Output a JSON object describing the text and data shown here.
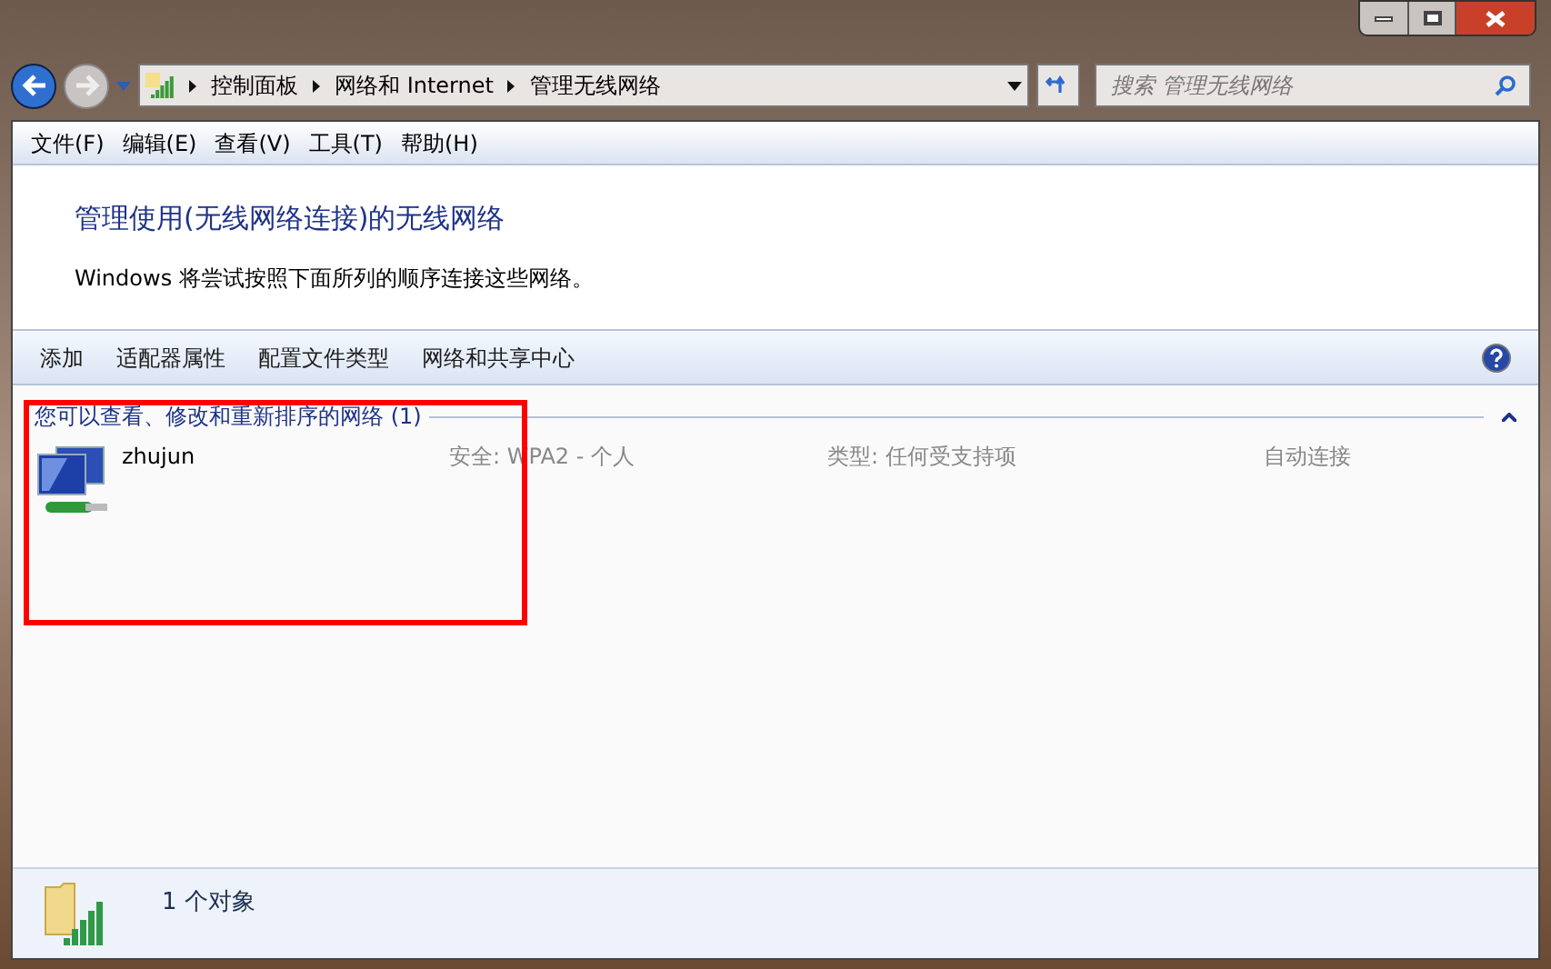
{
  "address_bar": {
    "crumbs": [
      "控制面板",
      "网络和 Internet",
      "管理无线网络"
    ]
  },
  "search": {
    "placeholder": "搜索 管理无线网络"
  },
  "menu": [
    "文件(F)",
    "编辑(E)",
    "查看(V)",
    "工具(T)",
    "帮助(H)"
  ],
  "header": {
    "title": "管理使用(无线网络连接)的无线网络",
    "subtitle": "Windows 将尝试按照下面所列的顺序连接这些网络。"
  },
  "toolbar": [
    "添加",
    "适配器属性",
    "配置文件类型",
    "网络和共享中心"
  ],
  "group": {
    "title": "您可以查看、修改和重新排序的网络 (1)",
    "expanded": true
  },
  "networks": [
    {
      "name": "zhujun",
      "security": "安全: WPA2 - 个人",
      "type": "类型: 任何受支持项",
      "mode": "自动连接"
    }
  ],
  "status_bar": {
    "text": "1 个对象"
  }
}
